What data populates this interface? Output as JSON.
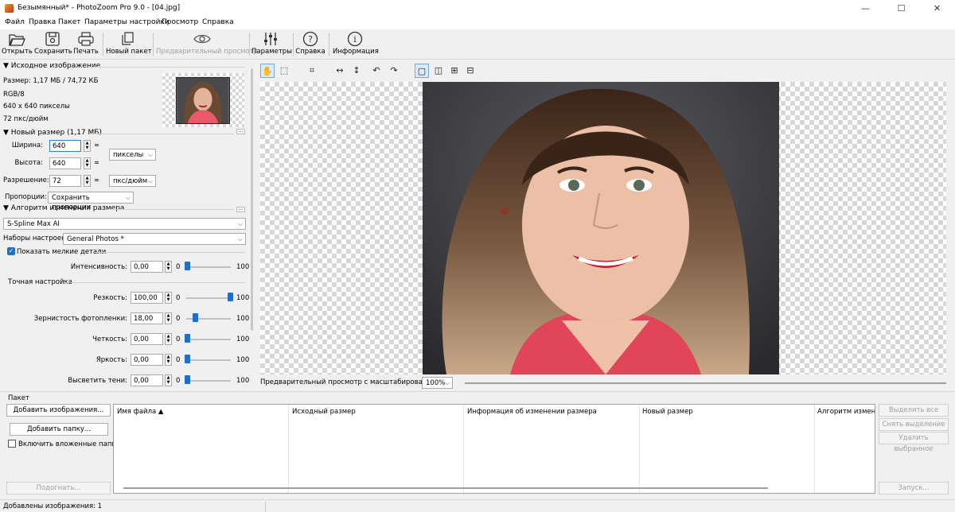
{
  "window": {
    "title": "Безымянный* - PhotoZoom Pro 9.0 - [04.jpg]"
  },
  "menu": [
    "Файл",
    "Правка",
    "Пакет",
    "Параметры настройки",
    "Просмотр",
    "Справка"
  ],
  "toolbar": {
    "open": "Открыть",
    "save": "Сохранить",
    "print": "Печать",
    "new_batch": "Новый пакет",
    "preview": "Предварительный просмотр",
    "params": "Параметры",
    "help": "Справка",
    "info": "Информация"
  },
  "source": {
    "title": "Исходное изображение",
    "size": "Размер: 1,17 МБ / 74,72 КБ",
    "mode": "RGB/8",
    "dims": "640 x 640 пикселы",
    "dpi": "72 пкс/дюйм"
  },
  "newsize": {
    "title": "Новый размер (1,17 МБ)",
    "width_label": "Ширина:",
    "width": "640",
    "height_label": "Высота:",
    "height": "640",
    "res_label": "Разрешение:",
    "res": "72",
    "unit": "пикселы",
    "res_unit": "пкс/дюйм",
    "prop_label": "Пропорции:",
    "prop": "Сохранить пропорции"
  },
  "algo": {
    "title": "Алгоритм изменения размера",
    "method": "S-Spline Max AI",
    "preset_label": "Наборы настроек:",
    "preset": "General Photos *",
    "small_details": "Показать мелкие детали",
    "intensity_label": "Интенсивность:",
    "intensity": "0,00",
    "intensity_level": 0.0,
    "fine_title": "Точная настройка",
    "sharp_label": "Резкость:",
    "sharp": "100,00",
    "sharp_level": 1.0,
    "grain_label": "Зернистость фотопленки:",
    "grain": "18,00",
    "grain_level": 0.18,
    "clarity_label": "Четкость:",
    "clarity": "0,00",
    "clarity_level": 0.0,
    "bright_label": "Яркость:",
    "bright": "0,00",
    "bright_level": 0.0,
    "shadows_label": "Высветить тени:",
    "shadows": "0,00",
    "shadows_level": 0.0,
    "min": "0",
    "max": "100"
  },
  "zoom": {
    "label": "Предварительный просмотр с масштабированием:",
    "value": "100%"
  },
  "batch": {
    "title": "Пакет",
    "add_images": "Добавить изображения...",
    "add_folder": "Добавить папку...",
    "subfolders": "Включить вложенные папки",
    "fit": "Подогнать...",
    "cols": [
      "Имя файла ▲",
      "Исходный размер",
      "Информация об изменении размера",
      "Новый размер",
      "Алгоритм изменен"
    ],
    "select_all": "Выделить все",
    "deselect": "Снять выделение",
    "remove": "Удалить выбранное",
    "start": "Запуск..."
  },
  "status": "Добавлены изображения: 1"
}
